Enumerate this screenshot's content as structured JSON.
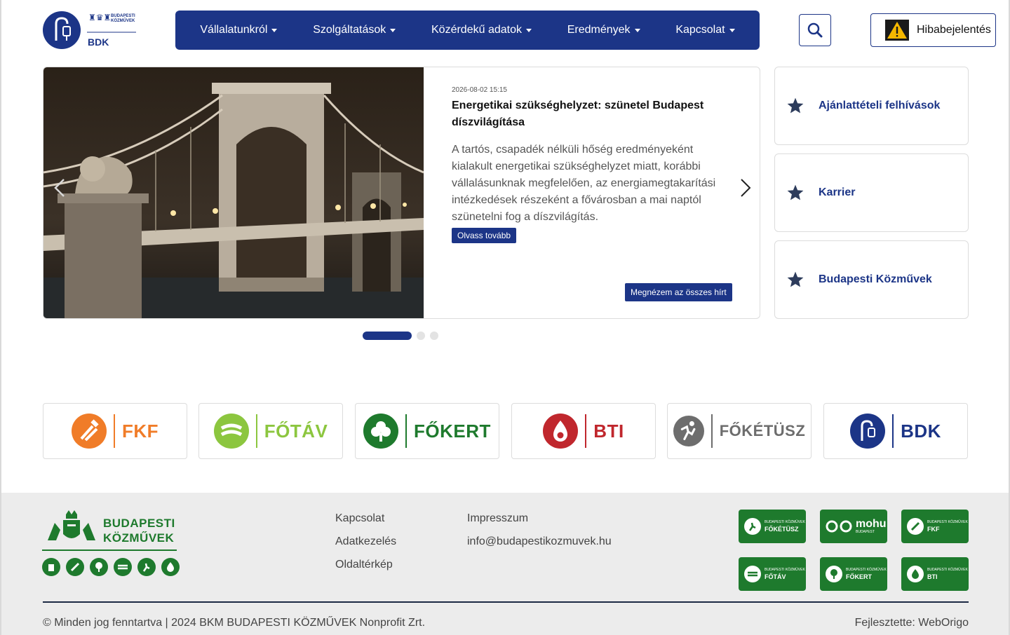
{
  "header": {
    "logo_text": "BDK",
    "logo_sub": "BUDAPESTI KÖZMŰVEK",
    "nav": [
      {
        "label": "Vállalatunkról"
      },
      {
        "label": "Szolgáltatások"
      },
      {
        "label": "Közérdekű adatok"
      },
      {
        "label": "Eredmények"
      },
      {
        "label": "Kapcsolat"
      }
    ],
    "report_label": "Hibabejelentés"
  },
  "slide": {
    "date": "2026-08-02 15:15",
    "title": "Energetikai szükséghelyzet: szünetel Budapest díszvilágítása",
    "text": "A tartós, csapadék nélküli hőség eredményeként kialakult energetikai szükséghelyzet miatt, korábbi vállalásunknak megfelelően, az energiamegtakarítási intézkedések részeként a fővárosban a mai naptól szünetelni fog a díszvilágítás.",
    "read_more": "Olvass tovább",
    "all_news": "Megnézem az összes hírt"
  },
  "side_cards": [
    {
      "label": "Ajánlattételi felhívások"
    },
    {
      "label": "Karrier"
    },
    {
      "label": "Budapesti Közművek"
    }
  ],
  "partners": [
    {
      "name": "FKF",
      "color": "#f07c28"
    },
    {
      "name": "FŐTÁV",
      "color": "#8cc63f"
    },
    {
      "name": "FŐKERT",
      "color": "#1e7a2d"
    },
    {
      "name": "BTI",
      "color": "#c0272d"
    },
    {
      "name": "FŐKÉTÜSZ",
      "color": "#6d6d6d"
    },
    {
      "name": "BDK",
      "color": "#1c3587"
    }
  ],
  "footer": {
    "brand_line1": "BUDAPESTI",
    "brand_line2": "KÖZMŰVEK",
    "links_col1": [
      "Kapcsolat",
      "Adatkezelés",
      "Oldaltérkép"
    ],
    "links_col2": [
      "Impresszum",
      "info@budapestikozmuvek.hu"
    ],
    "badges": [
      "FŐKÉTÜSZ",
      "mohu",
      "FKF",
      "FŐTÁV",
      "FŐKERT",
      "BTI"
    ],
    "badge_sub": "BUDAPESTI KÖZMŰVEK",
    "mohu_sub": "BUDAPEST",
    "copyright": "© Minden jog fenntartva | 2024 BKM BUDAPESTI KÖZMŰVEK Nonprofit Zrt.",
    "developer": "Fejlesztette: WebOrigo"
  },
  "colors": {
    "primary": "#1c3587",
    "footer_green": "#1e7a2d"
  }
}
